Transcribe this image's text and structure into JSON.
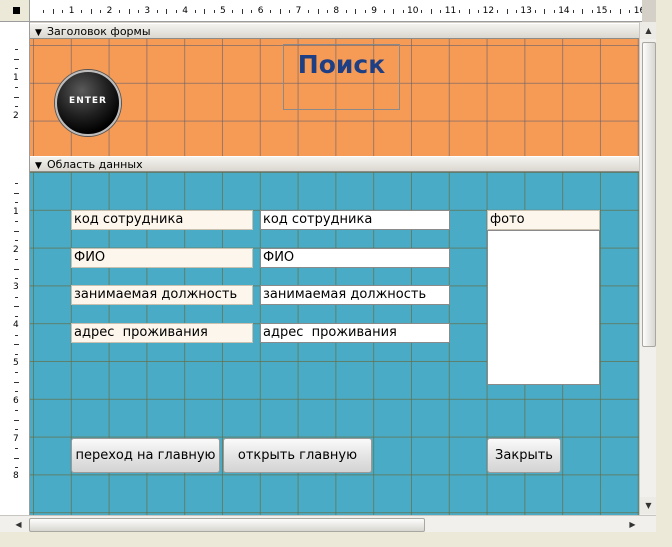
{
  "ruler": {
    "h_numbers": [
      "1",
      "2",
      "3",
      "4",
      "5",
      "6",
      "7",
      "8",
      "9",
      "10",
      "11",
      "12",
      "13",
      "14",
      "15",
      "16"
    ],
    "v_numbers": [
      "1",
      "2",
      "1",
      "2",
      "3",
      "4",
      "5",
      "6",
      "7",
      "8"
    ]
  },
  "sections": {
    "header": "Заголовок формы",
    "detail": "Область данных"
  },
  "form": {
    "title": "Поиск",
    "logo_text": "ENTER",
    "labels": [
      "код сотрудника",
      "ФИО",
      "занимаемая должность",
      "адрес  проживания",
      "фото"
    ],
    "fields": [
      "код сотрудника",
      "ФИО",
      "занимаемая должность",
      "адрес  проживания"
    ],
    "buttons": {
      "go_main": "переход на главную",
      "open_main": "открыть главную",
      "close": "Закрыть"
    }
  },
  "colors": {
    "header_bg": "#f59b56",
    "detail_bg": "#4aabc6",
    "title": "#1f3f85"
  },
  "icons": {
    "section_marker": "section-arrow-icon",
    "logo": "enter-logo-icon"
  }
}
